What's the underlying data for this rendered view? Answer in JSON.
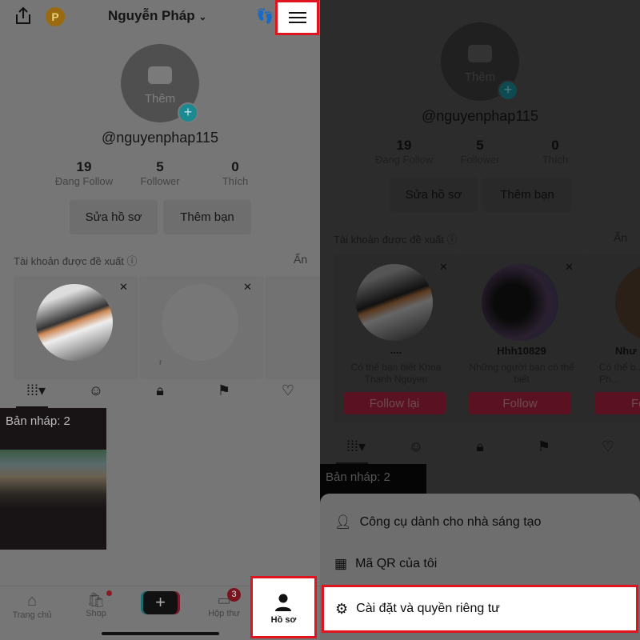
{
  "profile": {
    "name": "Nguyễn Pháp",
    "coin_letter": "P",
    "avatar_label": "Thêm",
    "username": "@nguyenphap115",
    "stats": [
      {
        "value": "19",
        "label": "Đang Follow"
      },
      {
        "value": "5",
        "label": "Follower"
      },
      {
        "value": "0",
        "label": "Thích"
      }
    ],
    "edit_button": "Sửa hồ sơ",
    "add_friend_button": "Thêm bạn"
  },
  "suggested": {
    "title": "Tài khoản được đề xuất",
    "hide": "Ẩn",
    "cards": [
      {
        "name": "....",
        "subtitle": "Có thể bạn biết Khoa Thanh Nguyen",
        "button": "Follow lại"
      },
      {
        "name": "Hhh10829",
        "subtitle": "Những người bạn có thể biết",
        "button": "Follow"
      },
      {
        "name": "Như",
        "subtitle": "Có thể b... Ph...",
        "button": "Fo"
      }
    ],
    "stray_char": "r"
  },
  "drafts": {
    "label": "Bản nháp: 2"
  },
  "bottom_nav": [
    {
      "label": "Trang chủ",
      "icon": "home-icon"
    },
    {
      "label": "Shop",
      "icon": "shop-icon"
    },
    {
      "label": "",
      "icon": "plus-icon"
    },
    {
      "label": "Hộp thư",
      "icon": "inbox-icon",
      "badge": "3"
    },
    {
      "label": "Hồ sơ",
      "icon": "profile-icon"
    }
  ],
  "menu": [
    {
      "label": "Công cụ dành cho nhà sáng tạo",
      "icon": "creator-tools-icon"
    },
    {
      "label": "Mã QR của tôi",
      "icon": "qr-code-icon"
    },
    {
      "label": "Cài đặt và quyền riêng tư",
      "icon": "gear-icon"
    }
  ],
  "colors": {
    "highlight": "#e0141e",
    "teal": "#1a9aa0",
    "follow_red": "#5a1222"
  }
}
